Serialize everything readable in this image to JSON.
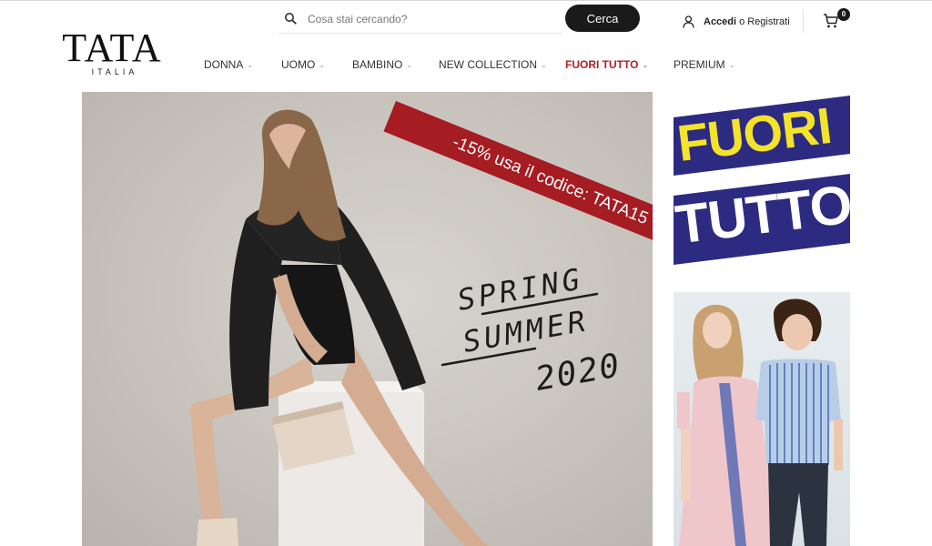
{
  "header": {
    "logo": {
      "name": "TATA",
      "tagline": "ITALIA"
    },
    "search": {
      "placeholder": "Cosa stai cercando?",
      "button_label": "Cerca"
    },
    "account": {
      "login_label": "Accedi",
      "connector": "o",
      "register_label": "Registrati"
    },
    "cart": {
      "count": "0"
    }
  },
  "nav": {
    "items": [
      {
        "label": "DONNA"
      },
      {
        "label": "UOMO"
      },
      {
        "label": "BAMBINO"
      },
      {
        "label": "NEW COLLECTION"
      },
      {
        "label": "FUORI TUTTO"
      },
      {
        "label": "PREMIUM"
      }
    ]
  },
  "hero": {
    "promo": "-15% usa il codice: TATA15",
    "headline": {
      "line1": "SPRING",
      "line2": "SUMMER",
      "line3": "2020"
    }
  },
  "side": {
    "sale_banner": {
      "line1": "FUORI",
      "line2": "TUTTO"
    }
  },
  "colors": {
    "accent_red": "#b21f24",
    "banner_blue": "#2d2a82",
    "banner_yellow": "#f3e32b",
    "button_dark": "#1a1a1a"
  }
}
